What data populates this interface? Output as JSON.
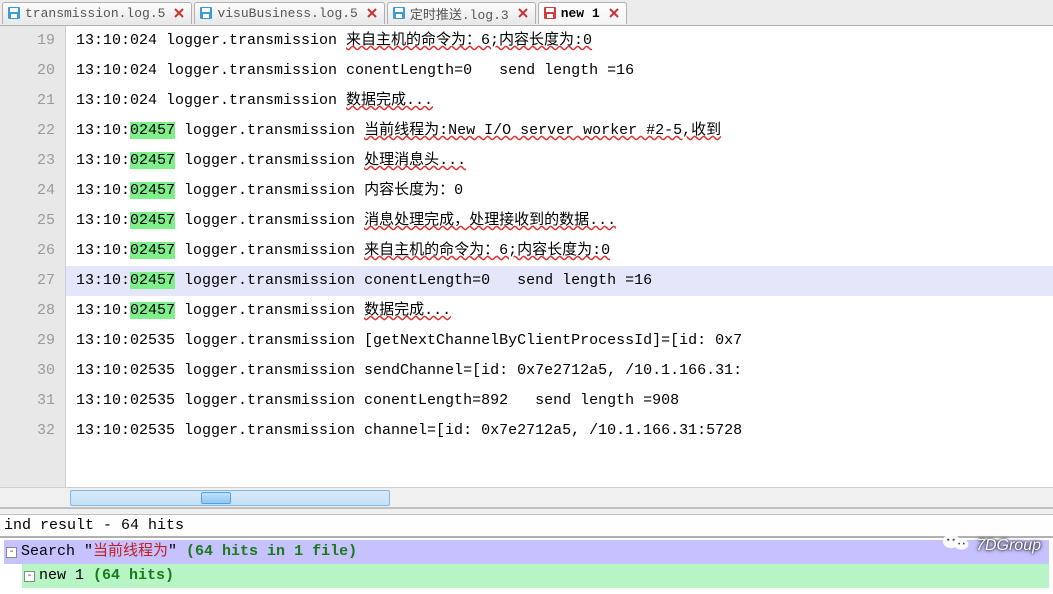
{
  "tabs": [
    {
      "label": "transmission.log.5",
      "color": "#3a9bd6",
      "active": false
    },
    {
      "label": "visuBusiness.log.5",
      "color": "#3a9bd6",
      "active": false
    },
    {
      "label": "定时推送.log.3",
      "color": "#3a9bd6",
      "active": false
    },
    {
      "label": "new  1",
      "color": "#d63a3a",
      "active": true
    }
  ],
  "gutter_start": 19,
  "lines": [
    {
      "n": 19,
      "pre": "13:10:024 logger.transmission ",
      "hl": "",
      "post": "",
      "msg": "来自主机的命令为：6;内容长度为:0",
      "spell": true
    },
    {
      "n": 20,
      "pre": "13:10:024 logger.transmission ",
      "hl": "",
      "post": "",
      "msg": "conentLength=0   send length =16",
      "spell": false
    },
    {
      "n": 21,
      "pre": "13:10:024 logger.transmission ",
      "hl": "",
      "post": "",
      "msg": "数据完成...",
      "spell": true
    },
    {
      "n": 22,
      "pre": "13:10:",
      "hl": "02457",
      "post": " logger.transmission ",
      "msg": "当前线程为:New I/O server worker #2-5,收到",
      "spell": true
    },
    {
      "n": 23,
      "pre": "13:10:",
      "hl": "02457",
      "post": " logger.transmission ",
      "msg": "处理消息头...",
      "spell": true
    },
    {
      "n": 24,
      "pre": "13:10:",
      "hl": "02457",
      "post": " logger.transmission ",
      "msg": "内容长度为：0",
      "spell": false
    },
    {
      "n": 25,
      "pre": "13:10:",
      "hl": "02457",
      "post": " logger.transmission ",
      "msg": "消息处理完成，处理接收到的数据...",
      "spell": true
    },
    {
      "n": 26,
      "pre": "13:10:",
      "hl": "02457",
      "post": " logger.transmission ",
      "msg": "来自主机的命令为：6;内容长度为:0",
      "spell": true
    },
    {
      "n": 27,
      "pre": "13:10:",
      "hl": "02457",
      "post": " logger.transmission ",
      "msg": "conentLength=0   send length =16",
      "spell": false,
      "current": true
    },
    {
      "n": 28,
      "pre": "13:10:",
      "hl": "02457",
      "post": " logger.transmission ",
      "msg": "数据完成...",
      "spell": true
    },
    {
      "n": 29,
      "pre": "13:10:02535 logger.transmission ",
      "hl": "",
      "post": "",
      "msg": "[getNextChannelByClientProcessId]=[id: 0x7",
      "spell": false
    },
    {
      "n": 30,
      "pre": "13:10:02535 logger.transmission ",
      "hl": "",
      "post": "",
      "msg": "sendChannel=[id: 0x7e2712a5, /10.1.166.31:",
      "spell": false
    },
    {
      "n": 31,
      "pre": "13:10:02535 logger.transmission ",
      "hl": "",
      "post": "",
      "msg": "conentLength=892   send length =908",
      "spell": false
    },
    {
      "n": 32,
      "pre": "13:10:02535 logger.transmission ",
      "hl": "",
      "post": "",
      "msg": "channel=[id: 0x7e2712a5, /10.1.166.31:5728",
      "spell": false
    }
  ],
  "find": {
    "status": "ind result - 64 hits",
    "search_prefix": "Search \"",
    "search_term": "当前线程为",
    "search_suffix_a": "\" ",
    "search_meta": "(64 hits in 1 file)",
    "file_label": "new  1 ",
    "file_meta": "(64 hits)"
  },
  "watermark": {
    "text": "7DGroup"
  }
}
